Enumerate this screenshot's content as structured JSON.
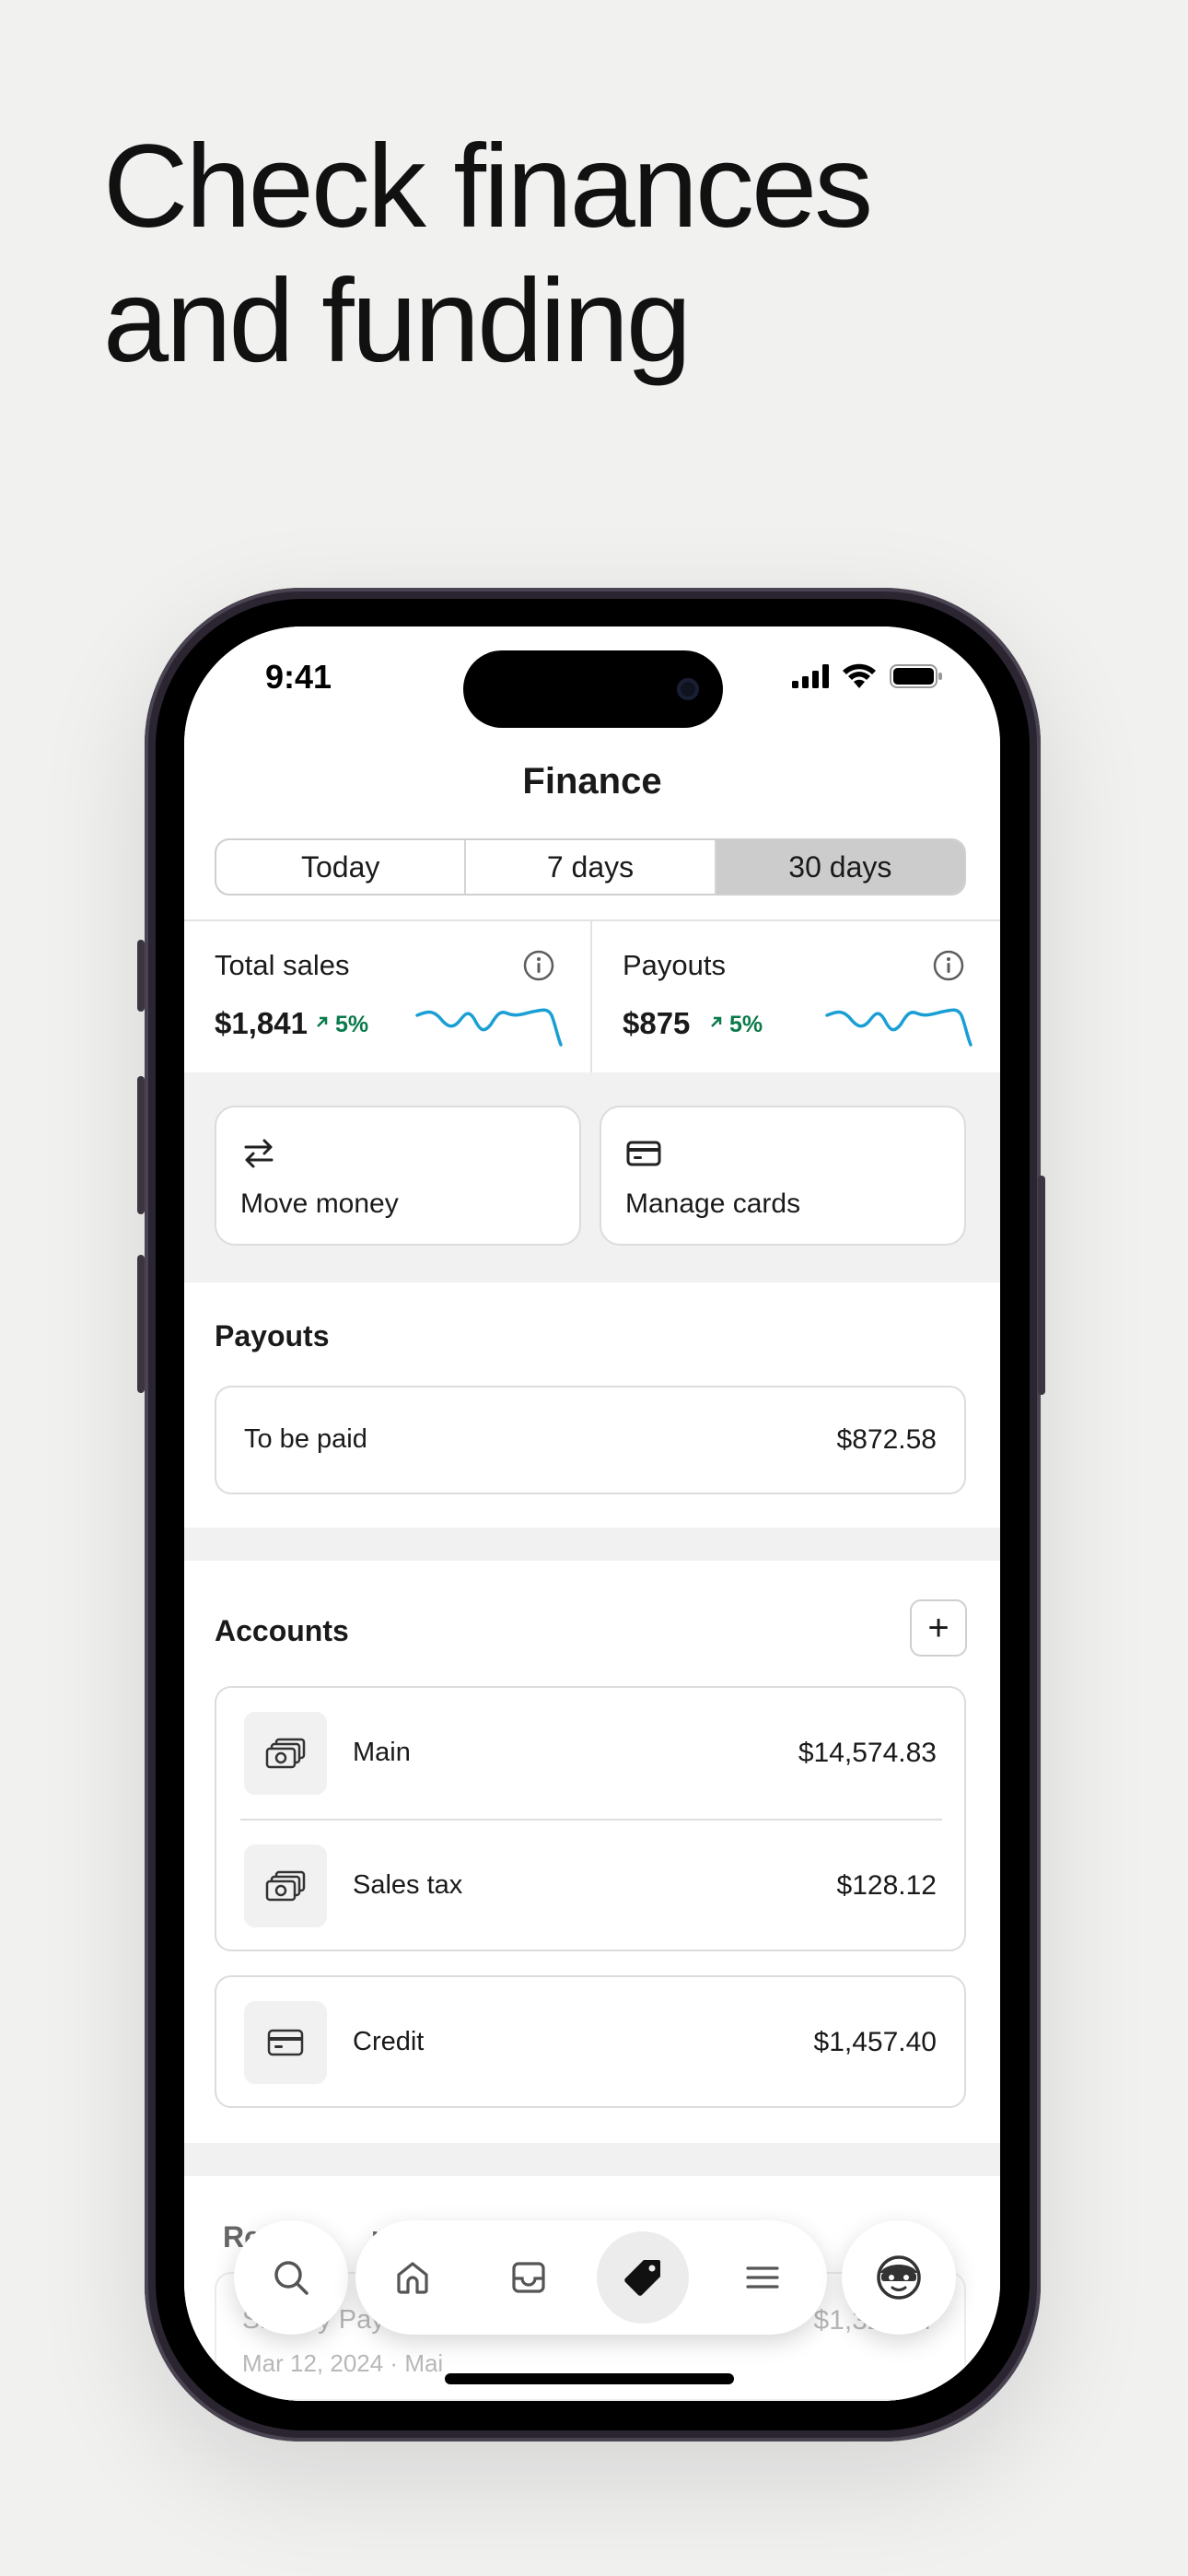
{
  "headline": [
    "Check finances",
    "and funding"
  ],
  "status_bar": {
    "time": "9:41"
  },
  "screen_title": "Finance",
  "segments": [
    {
      "label": "Today",
      "active": false
    },
    {
      "label": "7 days",
      "active": false
    },
    {
      "label": "30 days",
      "active": true
    }
  ],
  "metrics": [
    {
      "label": "Total sales",
      "value": "$1,841",
      "change": "5%"
    },
    {
      "label": "Payouts",
      "value": "$875",
      "change": "5%"
    }
  ],
  "actions": [
    {
      "label": "Move money",
      "icon": "arrows-swap-icon"
    },
    {
      "label": "Manage cards",
      "icon": "card-icon"
    }
  ],
  "payouts": {
    "title": "Payouts",
    "row_label": "To be paid",
    "row_amount": "$872.58"
  },
  "accounts": {
    "title": "Accounts",
    "add_label": "+",
    "items": [
      {
        "name": "Main",
        "amount": "$14,574.83",
        "icon": "cash-stack-icon"
      },
      {
        "name": "Sales tax",
        "amount": "$128.12",
        "icon": "cash-stack-icon"
      },
      {
        "name": "Credit",
        "amount": "$1,457.40",
        "icon": "card-icon"
      }
    ]
  },
  "recent_transactions": {
    "title_partial_left": "Re",
    "title_partial_right": "ran",
    "item_name": "Shopify Payout",
    "item_amount": "$1,325.87",
    "item_meta": "Mar 12, 2024 · Mai"
  },
  "tabbar": {
    "items": [
      "search-icon",
      "home-icon",
      "inbox-icon",
      "tag-icon",
      "menu-icon",
      "avatar"
    ],
    "active": "tag-icon"
  },
  "colors": {
    "positive": "#0a7a4a",
    "sparkline": "#1a9fd4",
    "segment_active": "#cccccc"
  }
}
